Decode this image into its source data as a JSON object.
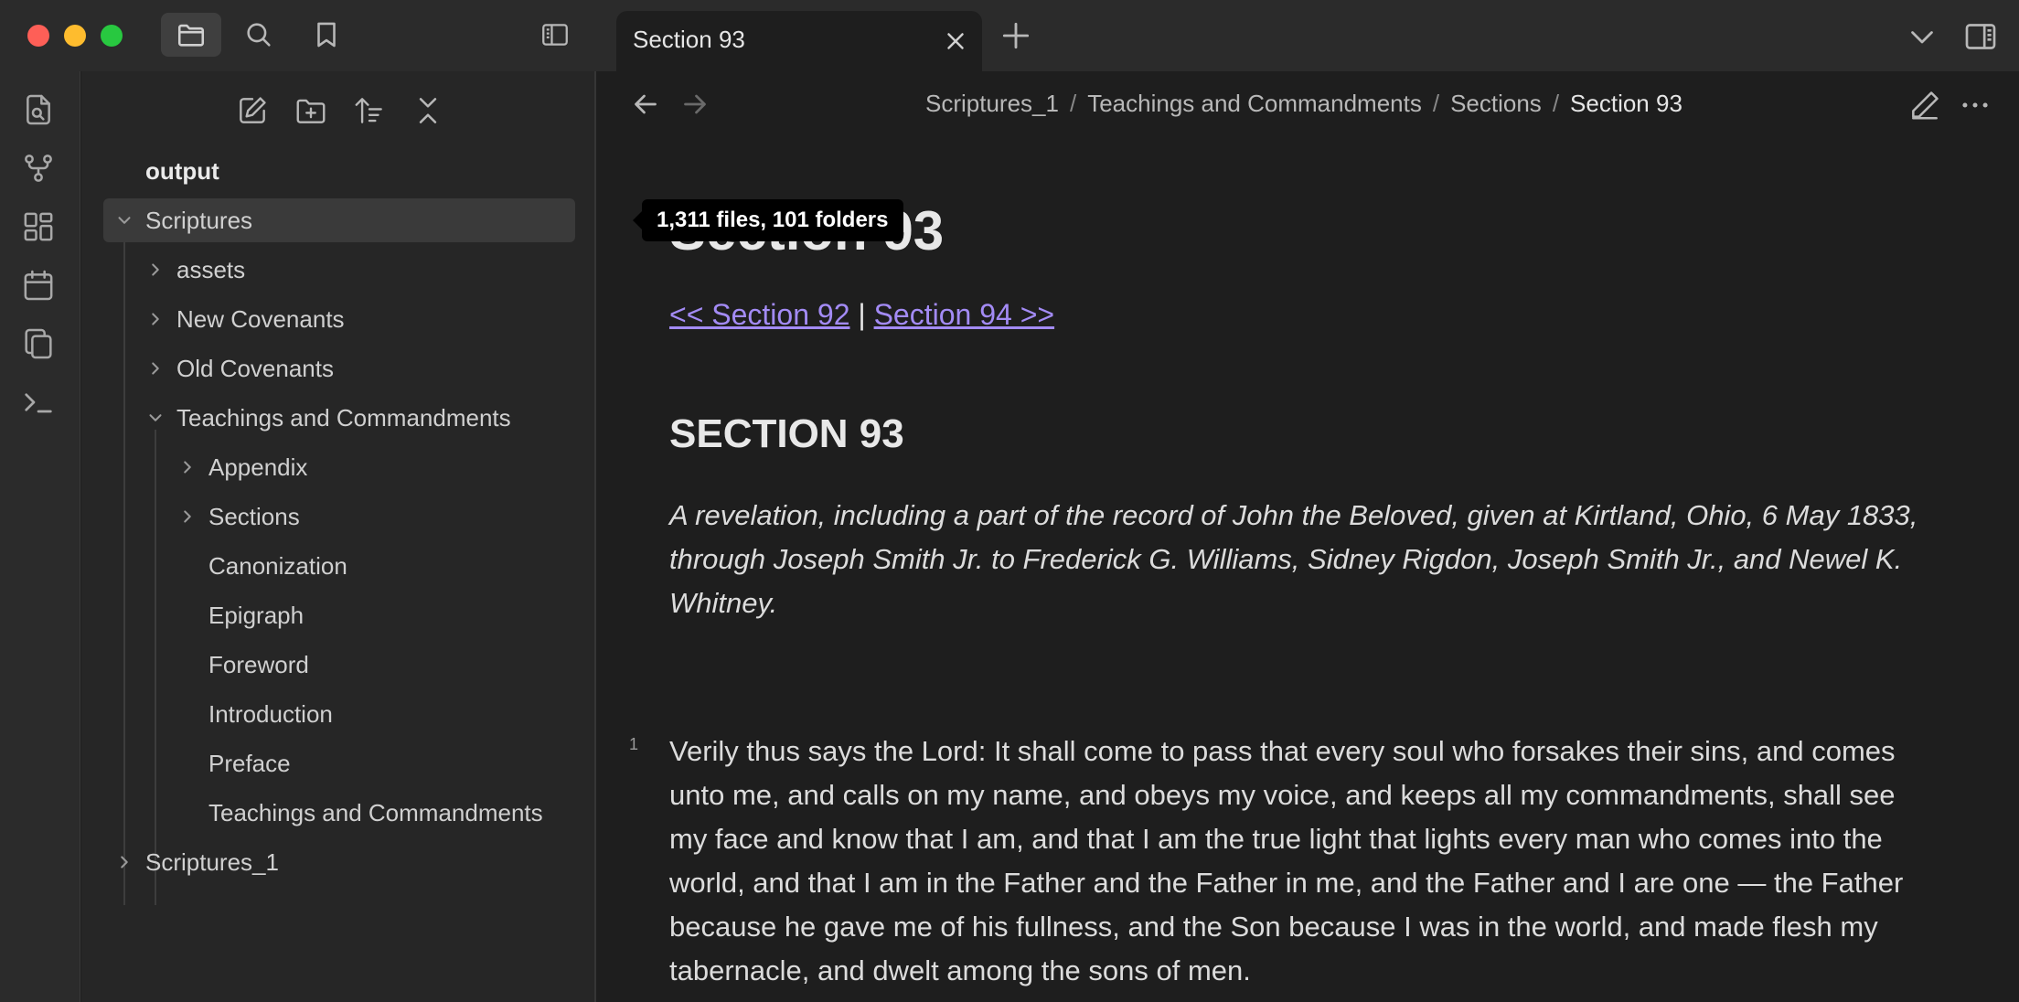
{
  "tab": {
    "title": "Section 93"
  },
  "explorer": {
    "items": [
      {
        "label": "output"
      },
      {
        "label": "Scriptures"
      },
      {
        "label": "assets"
      },
      {
        "label": "New Covenants"
      },
      {
        "label": "Old Covenants"
      },
      {
        "label": "Teachings and Commandments"
      },
      {
        "label": "Appendix"
      },
      {
        "label": "Sections"
      },
      {
        "label": "Canonization"
      },
      {
        "label": "Epigraph"
      },
      {
        "label": "Foreword"
      },
      {
        "label": "Introduction"
      },
      {
        "label": "Preface"
      },
      {
        "label": "Teachings and Commandments"
      },
      {
        "label": "Scriptures_1"
      }
    ],
    "tooltip": "1,311 files, 101 folders"
  },
  "breadcrumb": {
    "parts": [
      "Scriptures_1",
      "Teachings and Commandments",
      "Sections",
      "Section 93"
    ],
    "separator": "/"
  },
  "note": {
    "title": "Section 93",
    "prev_link": "<< Section 92",
    "link_separator": " | ",
    "next_link": "Section 94 >>",
    "heading": "SECTION 93",
    "intro": "A revelation, including a part of the record of John the Beloved, given at Kirtland, Ohio, 6 May 1833, through Joseph Smith Jr. to Frederick G. Williams, Sidney Rigdon, Joseph Smith Jr., and Newel K. Whitney.",
    "verse_number": "1",
    "verse_text": "Verily thus says the Lord: It shall come to pass that every soul who forsakes their sins, and comes unto me, and calls on my name, and obeys my voice, and keeps all my commandments, shall see my face and know that I am, and that I am the true light that lights every man who comes into the world, and that I am in the Father and the Father in me, and the Father and I are one — the Father because he gave me of his fullness, and the Son because I was in the world, and made flesh my tabernacle, and dwelt among the sons of men."
  },
  "colors": {
    "link": "#a38bf5",
    "background": "#1e1e1e",
    "sidebar": "#262626",
    "close": "#fe5f57",
    "minimize": "#febc2e",
    "maximize": "#28c840"
  }
}
